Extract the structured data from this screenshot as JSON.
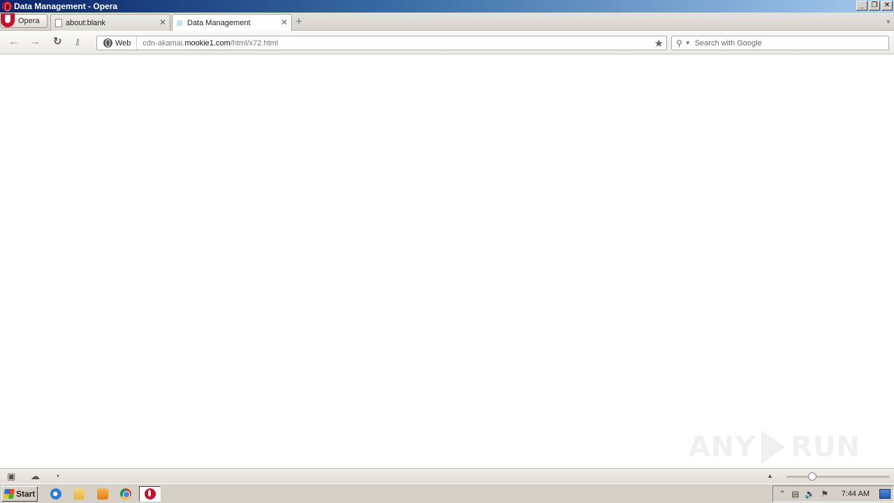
{
  "window": {
    "title": "Data Management - Opera",
    "controls": {
      "minimize": "_",
      "maximize": "❐",
      "close": "✕"
    }
  },
  "browser": {
    "menu_label": "Opera",
    "tabs": [
      {
        "label": "about:blank",
        "close": "✕",
        "active": false
      },
      {
        "label": "Data Management",
        "close": "✕",
        "active": true
      }
    ],
    "new_tab": "+",
    "tab_menu": "▾"
  },
  "toolbar": {
    "back": "←",
    "forward": "→",
    "reload": "↻",
    "key": "⚷",
    "site_badge": "Web",
    "url_prefix": "cdn-akamai.",
    "url_host": "mookie1.com",
    "url_path": "/html/x72.html",
    "star": "★",
    "search_placeholder": "Search with Google",
    "search_value": ""
  },
  "content": {
    "watermark_left": "ANY",
    "watermark_right": "RUN"
  },
  "statusbar": {
    "panel_icon": "▣",
    "cloud_icon": "☁",
    "speed_icon": "◔",
    "up_icon": "▲",
    "zoom_fraction": 0.25
  },
  "taskbar": {
    "start_label": "Start",
    "clock": "7:44 AM",
    "tray_icons": [
      "⌃",
      "▤",
      "🔈",
      "⚑"
    ]
  },
  "colors": {
    "titlebar_start": "#0a246a",
    "titlebar_end": "#a6caf0",
    "opera_red": "#c8102e",
    "taskbar": "#d4d0c8"
  }
}
